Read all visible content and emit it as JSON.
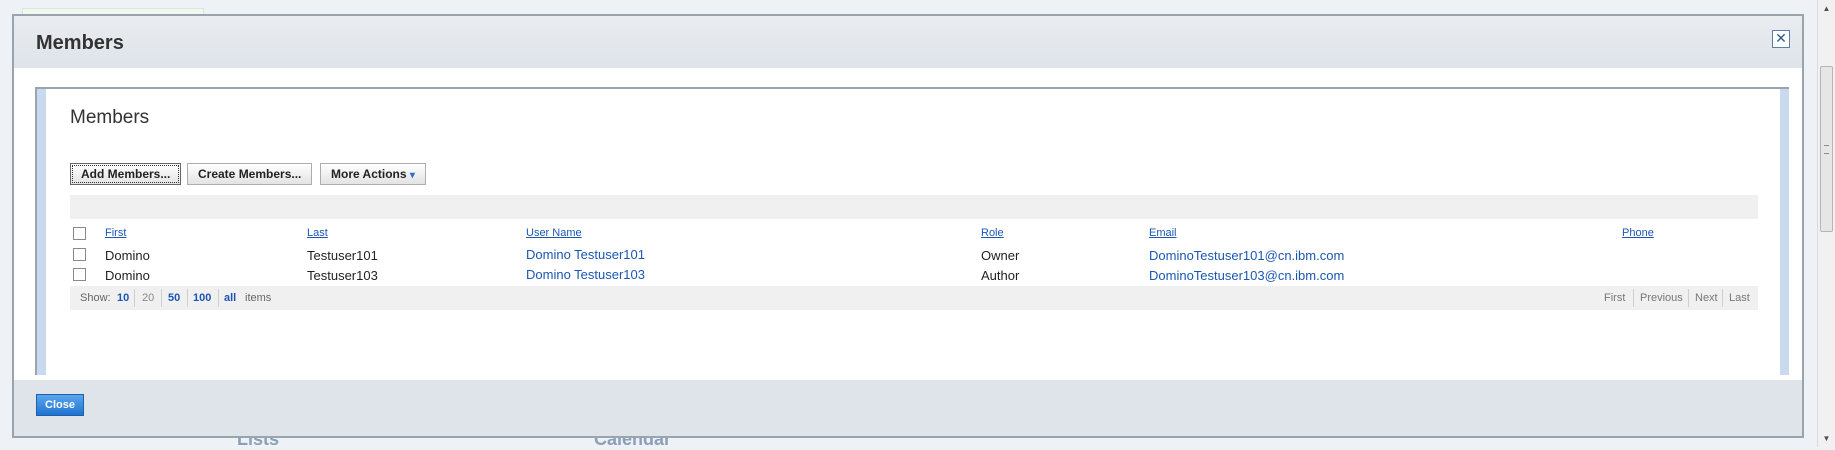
{
  "background": {
    "label_left": "Lists",
    "label_right": "Calendar"
  },
  "dialog": {
    "title": "Members",
    "close_icon": "close-icon",
    "footer_close": "Close"
  },
  "panel": {
    "title": "Members"
  },
  "toolbar": {
    "add_members": "Add Members...",
    "create_members": "Create Members...",
    "more_actions": "More Actions",
    "more_actions_icon": "▾"
  },
  "table": {
    "columns": {
      "first": "First",
      "last": "Last",
      "user_name": "User Name",
      "role": "Role",
      "email": "Email",
      "phone": "Phone"
    },
    "rows": [
      {
        "first": "Domino",
        "last": "Testuser101",
        "user_name": "Domino Testuser101",
        "role": "Owner",
        "email": "DominoTestuser101@cn.ibm.com",
        "phone": ""
      },
      {
        "first": "Domino",
        "last": "Testuser103",
        "user_name": "Domino Testuser103",
        "role": "Author",
        "email": "DominoTestuser103@cn.ibm.com",
        "phone": ""
      }
    ]
  },
  "pager": {
    "show_label": "Show:",
    "sizes": [
      "10",
      "20",
      "50",
      "100",
      "all"
    ],
    "items_label": "items",
    "first": "First",
    "previous": "Previous",
    "next": "Next",
    "last": "Last"
  },
  "colors": {
    "link": "#1b57b1",
    "primary_button": "#2a7fd6",
    "header_bg": "#e4e8ed"
  }
}
